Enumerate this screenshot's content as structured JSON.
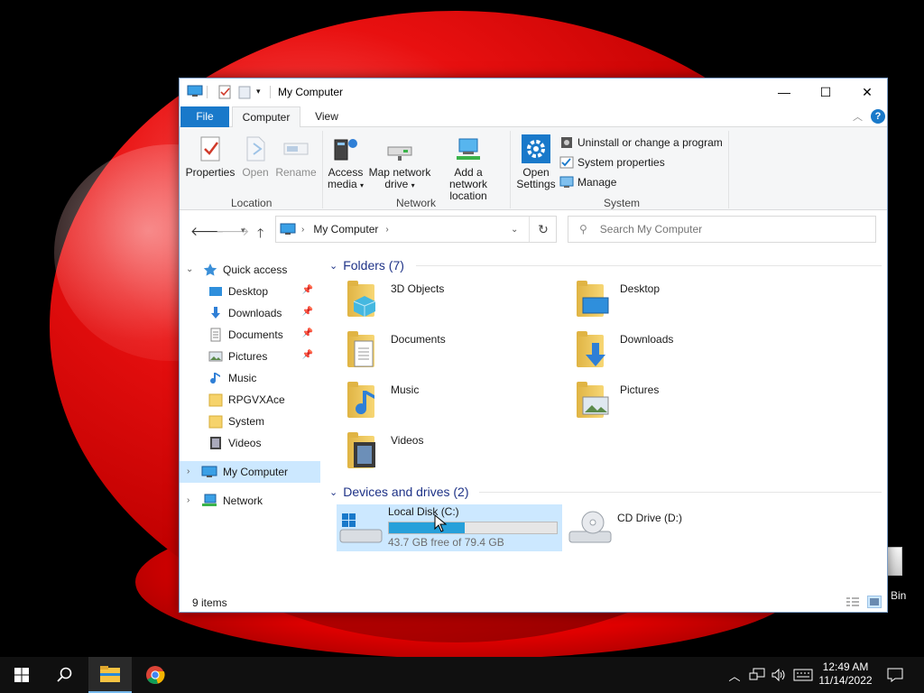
{
  "window": {
    "title": "My Computer",
    "tabs": {
      "file": "File",
      "computer": "Computer",
      "view": "View"
    },
    "controls": {
      "minimize": "—",
      "maximize": "☐",
      "close": "✕"
    }
  },
  "ribbon": {
    "location": {
      "group_label": "Location",
      "properties": "Properties",
      "open": "Open",
      "rename": "Rename"
    },
    "network": {
      "group_label": "Network",
      "access_media": "Access media",
      "map_network_drive": "Map network drive",
      "add_network_location": "Add a network location"
    },
    "system": {
      "group_label": "System",
      "open_settings": "Open Settings",
      "uninstall": "Uninstall or change a program",
      "system_properties": "System properties",
      "manage": "Manage"
    }
  },
  "address": {
    "path": "My Computer",
    "search_placeholder": "Search My Computer"
  },
  "nav_pane": {
    "quick_access": "Quick access",
    "items": [
      {
        "label": "Desktop",
        "pinned": true
      },
      {
        "label": "Downloads",
        "pinned": true
      },
      {
        "label": "Documents",
        "pinned": true
      },
      {
        "label": "Pictures",
        "pinned": true
      },
      {
        "label": "Music",
        "pinned": false
      },
      {
        "label": "RPGVXAce",
        "pinned": false
      },
      {
        "label": "System",
        "pinned": false
      },
      {
        "label": "Videos",
        "pinned": false
      }
    ],
    "my_computer": "My Computer",
    "network": "Network"
  },
  "content": {
    "folders_header": "Folders (7)",
    "folders": [
      "3D Objects",
      "Desktop",
      "Documents",
      "Downloads",
      "Music",
      "Pictures",
      "Videos"
    ],
    "devices_header": "Devices and drives (2)",
    "drives": [
      {
        "name": "Local Disk (C:)",
        "free_text": "43.7 GB free of 79.4 GB",
        "used_fraction": 0.45
      },
      {
        "name": "CD Drive (D:)"
      }
    ]
  },
  "status": {
    "items": "9 items"
  },
  "desktop": {
    "recycle_bin_label": "Bin"
  },
  "taskbar": {
    "time": "12:49 AM",
    "date": "11/14/2022"
  },
  "colors": {
    "accent": "#1979ca",
    "selection": "#cce8ff",
    "bar_fill": "#26a0da",
    "group_header": "#1e3287"
  }
}
